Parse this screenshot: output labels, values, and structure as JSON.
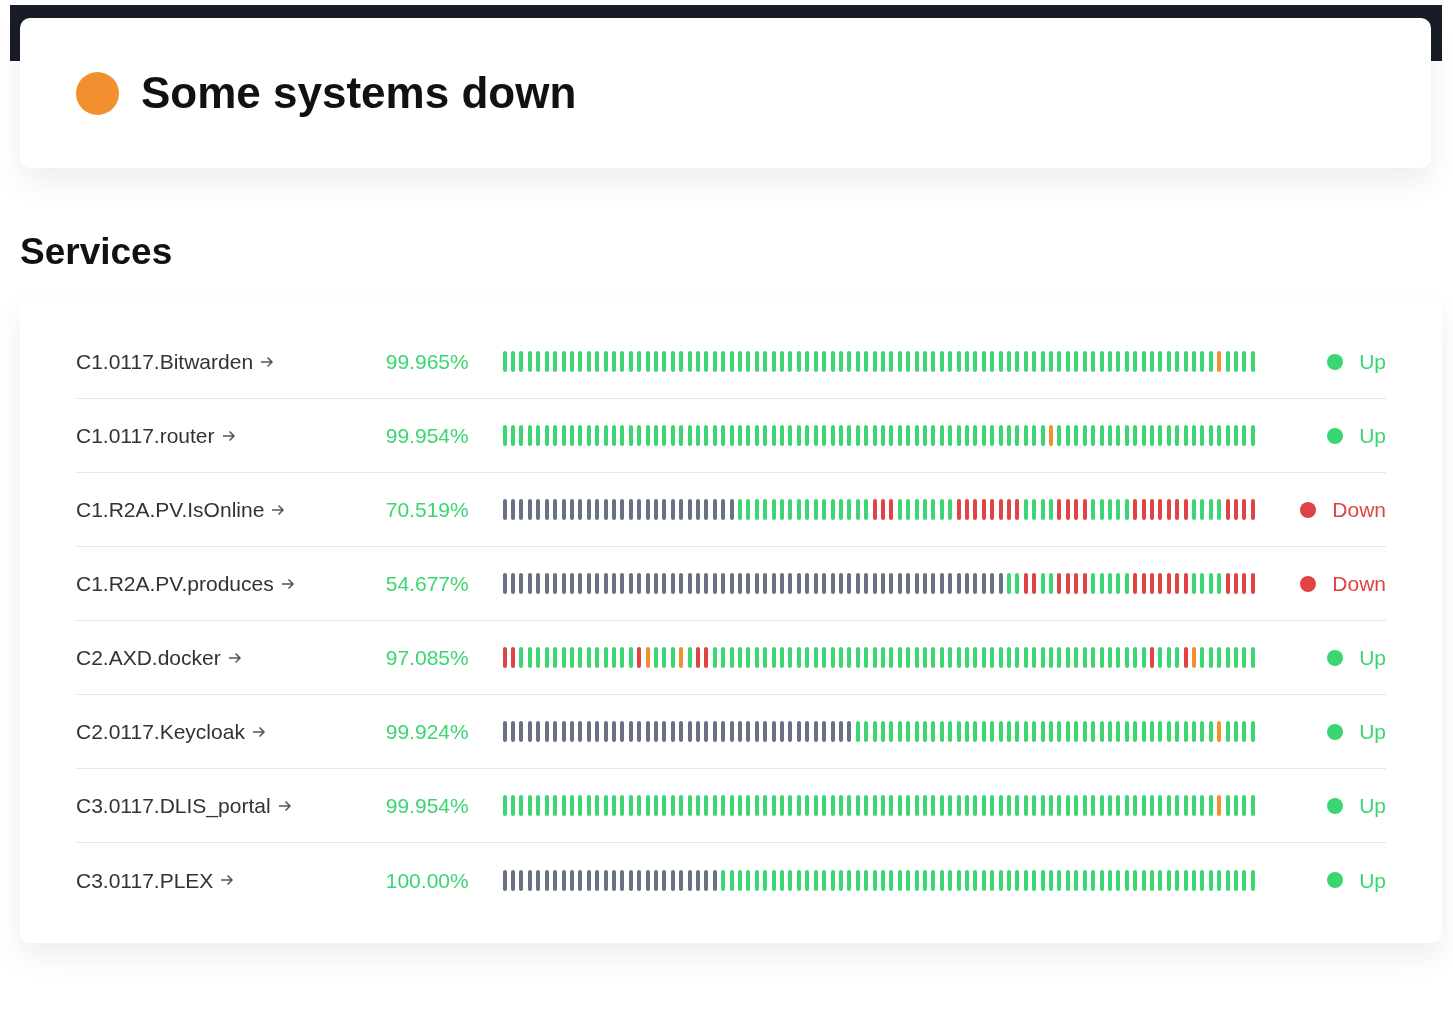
{
  "header": {
    "title": "Some systems down",
    "color": "#f29030"
  },
  "section_title": "Services",
  "services": [
    {
      "name": "C1.0117.Bitwarden",
      "uptime": "99.965%",
      "down": false,
      "status_label": "Up",
      "history": [
        {
          "color": "#3bd671"
        },
        {
          "color": "#3bd671"
        },
        {
          "color": "#3bd671"
        },
        {
          "color": "#3bd671"
        },
        {
          "color": "#3bd671"
        },
        {
          "color": "#3bd671"
        },
        {
          "color": "#3bd671"
        },
        {
          "color": "#3bd671"
        },
        {
          "color": "#3bd671"
        },
        {
          "color": "#3bd671"
        },
        {
          "color": "#3bd671"
        },
        {
          "color": "#3bd671"
        },
        {
          "color": "#3bd671"
        },
        {
          "color": "#3bd671"
        },
        {
          "color": "#3bd671"
        },
        {
          "color": "#3bd671"
        },
        {
          "color": "#3bd671"
        },
        {
          "color": "#3bd671"
        },
        {
          "color": "#3bd671"
        },
        {
          "color": "#3bd671"
        },
        {
          "color": "#3bd671"
        },
        {
          "color": "#3bd671"
        },
        {
          "color": "#3bd671"
        },
        {
          "color": "#3bd671"
        },
        {
          "color": "#3bd671"
        },
        {
          "color": "#3bd671"
        },
        {
          "color": "#3bd671"
        },
        {
          "color": "#3bd671"
        },
        {
          "color": "#3bd671"
        },
        {
          "color": "#3bd671"
        },
        {
          "color": "#3bd671"
        },
        {
          "color": "#3bd671"
        },
        {
          "color": "#3bd671"
        },
        {
          "color": "#3bd671"
        },
        {
          "color": "#3bd671"
        },
        {
          "color": "#3bd671"
        },
        {
          "color": "#3bd671"
        },
        {
          "color": "#3bd671"
        },
        {
          "color": "#3bd671"
        },
        {
          "color": "#3bd671"
        },
        {
          "color": "#3bd671"
        },
        {
          "color": "#3bd671"
        },
        {
          "color": "#3bd671"
        },
        {
          "color": "#3bd671"
        },
        {
          "color": "#3bd671"
        },
        {
          "color": "#3bd671"
        },
        {
          "color": "#3bd671"
        },
        {
          "color": "#3bd671"
        },
        {
          "color": "#3bd671"
        },
        {
          "color": "#3bd671"
        },
        {
          "color": "#3bd671"
        },
        {
          "color": "#3bd671"
        },
        {
          "color": "#3bd671"
        },
        {
          "color": "#3bd671"
        },
        {
          "color": "#3bd671"
        },
        {
          "color": "#3bd671"
        },
        {
          "color": "#3bd671"
        },
        {
          "color": "#3bd671"
        },
        {
          "color": "#3bd671"
        },
        {
          "color": "#3bd671"
        },
        {
          "color": "#3bd671"
        },
        {
          "color": "#3bd671"
        },
        {
          "color": "#3bd671"
        },
        {
          "color": "#3bd671"
        },
        {
          "color": "#3bd671"
        },
        {
          "color": "#3bd671"
        },
        {
          "color": "#3bd671"
        },
        {
          "color": "#3bd671"
        },
        {
          "color": "#3bd671"
        },
        {
          "color": "#3bd671"
        },
        {
          "color": "#3bd671"
        },
        {
          "color": "#3bd671"
        },
        {
          "color": "#3bd671"
        },
        {
          "color": "#3bd671"
        },
        {
          "color": "#3bd671"
        },
        {
          "color": "#3bd671"
        },
        {
          "color": "#3bd671"
        },
        {
          "color": "#3bd671"
        },
        {
          "color": "#3bd671"
        },
        {
          "color": "#3bd671"
        },
        {
          "color": "#3bd671"
        },
        {
          "color": "#3bd671"
        },
        {
          "color": "#3bd671"
        },
        {
          "color": "#3bd671"
        },
        {
          "color": "#3bd671"
        },
        {
          "color": "#f29030"
        },
        {
          "color": "#3bd671"
        },
        {
          "color": "#3bd671"
        },
        {
          "color": "#3bd671"
        },
        {
          "color": "#3bd671"
        }
      ]
    },
    {
      "name": "C1.0117.router",
      "uptime": "99.954%",
      "down": false,
      "status_label": "Up",
      "history": [
        {
          "color": "#3bd671"
        },
        {
          "color": "#3bd671"
        },
        {
          "color": "#3bd671"
        },
        {
          "color": "#3bd671"
        },
        {
          "color": "#3bd671"
        },
        {
          "color": "#3bd671"
        },
        {
          "color": "#3bd671"
        },
        {
          "color": "#3bd671"
        },
        {
          "color": "#3bd671"
        },
        {
          "color": "#3bd671"
        },
        {
          "color": "#3bd671"
        },
        {
          "color": "#3bd671"
        },
        {
          "color": "#3bd671"
        },
        {
          "color": "#3bd671"
        },
        {
          "color": "#3bd671"
        },
        {
          "color": "#3bd671"
        },
        {
          "color": "#3bd671"
        },
        {
          "color": "#3bd671"
        },
        {
          "color": "#3bd671"
        },
        {
          "color": "#3bd671"
        },
        {
          "color": "#3bd671"
        },
        {
          "color": "#3bd671"
        },
        {
          "color": "#3bd671"
        },
        {
          "color": "#3bd671"
        },
        {
          "color": "#3bd671"
        },
        {
          "color": "#3bd671"
        },
        {
          "color": "#3bd671"
        },
        {
          "color": "#3bd671"
        },
        {
          "color": "#3bd671"
        },
        {
          "color": "#3bd671"
        },
        {
          "color": "#3bd671"
        },
        {
          "color": "#3bd671"
        },
        {
          "color": "#3bd671"
        },
        {
          "color": "#3bd671"
        },
        {
          "color": "#3bd671"
        },
        {
          "color": "#3bd671"
        },
        {
          "color": "#3bd671"
        },
        {
          "color": "#3bd671"
        },
        {
          "color": "#3bd671"
        },
        {
          "color": "#3bd671"
        },
        {
          "color": "#3bd671"
        },
        {
          "color": "#3bd671"
        },
        {
          "color": "#3bd671"
        },
        {
          "color": "#3bd671"
        },
        {
          "color": "#3bd671"
        },
        {
          "color": "#3bd671"
        },
        {
          "color": "#3bd671"
        },
        {
          "color": "#3bd671"
        },
        {
          "color": "#3bd671"
        },
        {
          "color": "#3bd671"
        },
        {
          "color": "#3bd671"
        },
        {
          "color": "#3bd671"
        },
        {
          "color": "#3bd671"
        },
        {
          "color": "#3bd671"
        },
        {
          "color": "#3bd671"
        },
        {
          "color": "#3bd671"
        },
        {
          "color": "#3bd671"
        },
        {
          "color": "#3bd671"
        },
        {
          "color": "#3bd671"
        },
        {
          "color": "#3bd671"
        },
        {
          "color": "#3bd671"
        },
        {
          "color": "#3bd671"
        },
        {
          "color": "#3bd671"
        },
        {
          "color": "#3bd671"
        },
        {
          "color": "#3bd671"
        },
        {
          "color": "#f29030"
        },
        {
          "color": "#3bd671"
        },
        {
          "color": "#3bd671"
        },
        {
          "color": "#3bd671"
        },
        {
          "color": "#3bd671"
        },
        {
          "color": "#3bd671"
        },
        {
          "color": "#3bd671"
        },
        {
          "color": "#3bd671"
        },
        {
          "color": "#3bd671"
        },
        {
          "color": "#3bd671"
        },
        {
          "color": "#3bd671"
        },
        {
          "color": "#3bd671"
        },
        {
          "color": "#3bd671"
        },
        {
          "color": "#3bd671"
        },
        {
          "color": "#3bd671"
        },
        {
          "color": "#3bd671"
        },
        {
          "color": "#3bd671"
        },
        {
          "color": "#3bd671"
        },
        {
          "color": "#3bd671"
        },
        {
          "color": "#3bd671"
        },
        {
          "color": "#3bd671"
        },
        {
          "color": "#3bd671"
        },
        {
          "color": "#3bd671"
        },
        {
          "color": "#3bd671"
        },
        {
          "color": "#3bd671"
        }
      ]
    },
    {
      "name": "C1.R2A.PV.IsOnline",
      "uptime": "70.519%",
      "down": true,
      "status_label": "Down",
      "history": [
        {
          "color": "#687183"
        },
        {
          "color": "#687183"
        },
        {
          "color": "#687183"
        },
        {
          "color": "#687183"
        },
        {
          "color": "#687183"
        },
        {
          "color": "#687183"
        },
        {
          "color": "#687183"
        },
        {
          "color": "#687183"
        },
        {
          "color": "#687183"
        },
        {
          "color": "#687183"
        },
        {
          "color": "#687183"
        },
        {
          "color": "#687183"
        },
        {
          "color": "#687183"
        },
        {
          "color": "#687183"
        },
        {
          "color": "#687183"
        },
        {
          "color": "#687183"
        },
        {
          "color": "#687183"
        },
        {
          "color": "#687183"
        },
        {
          "color": "#687183"
        },
        {
          "color": "#687183"
        },
        {
          "color": "#687183"
        },
        {
          "color": "#687183"
        },
        {
          "color": "#687183"
        },
        {
          "color": "#687183"
        },
        {
          "color": "#687183"
        },
        {
          "color": "#687183"
        },
        {
          "color": "#687183"
        },
        {
          "color": "#687183"
        },
        {
          "color": "#3bd671"
        },
        {
          "color": "#3bd671"
        },
        {
          "color": "#3bd671"
        },
        {
          "color": "#3bd671"
        },
        {
          "color": "#3bd671"
        },
        {
          "color": "#3bd671"
        },
        {
          "color": "#3bd671"
        },
        {
          "color": "#3bd671"
        },
        {
          "color": "#3bd671"
        },
        {
          "color": "#3bd671"
        },
        {
          "color": "#3bd671"
        },
        {
          "color": "#3bd671"
        },
        {
          "color": "#3bd671"
        },
        {
          "color": "#3bd671"
        },
        {
          "color": "#3bd671"
        },
        {
          "color": "#3bd671"
        },
        {
          "color": "#e04343"
        },
        {
          "color": "#e04343"
        },
        {
          "color": "#e04343"
        },
        {
          "color": "#3bd671"
        },
        {
          "color": "#3bd671"
        },
        {
          "color": "#3bd671"
        },
        {
          "color": "#3bd671"
        },
        {
          "color": "#3bd671"
        },
        {
          "color": "#3bd671"
        },
        {
          "color": "#3bd671"
        },
        {
          "color": "#e04343"
        },
        {
          "color": "#e04343"
        },
        {
          "color": "#e04343"
        },
        {
          "color": "#e04343"
        },
        {
          "color": "#e04343"
        },
        {
          "color": "#e04343"
        },
        {
          "color": "#e04343"
        },
        {
          "color": "#e04343"
        },
        {
          "color": "#3bd671"
        },
        {
          "color": "#3bd671"
        },
        {
          "color": "#3bd671"
        },
        {
          "color": "#3bd671"
        },
        {
          "color": "#e04343"
        },
        {
          "color": "#e04343"
        },
        {
          "color": "#e04343"
        },
        {
          "color": "#e04343"
        },
        {
          "color": "#3bd671"
        },
        {
          "color": "#3bd671"
        },
        {
          "color": "#3bd671"
        },
        {
          "color": "#3bd671"
        },
        {
          "color": "#3bd671"
        },
        {
          "color": "#e04343"
        },
        {
          "color": "#e04343"
        },
        {
          "color": "#e04343"
        },
        {
          "color": "#e04343"
        },
        {
          "color": "#e04343"
        },
        {
          "color": "#e04343"
        },
        {
          "color": "#e04343"
        },
        {
          "color": "#3bd671"
        },
        {
          "color": "#3bd671"
        },
        {
          "color": "#3bd671"
        },
        {
          "color": "#3bd671"
        },
        {
          "color": "#e04343"
        },
        {
          "color": "#e04343"
        },
        {
          "color": "#e04343"
        },
        {
          "color": "#e04343"
        }
      ]
    },
    {
      "name": "C1.R2A.PV.produces",
      "uptime": "54.677%",
      "down": true,
      "status_label": "Down",
      "history": [
        {
          "color": "#687183"
        },
        {
          "color": "#687183"
        },
        {
          "color": "#687183"
        },
        {
          "color": "#687183"
        },
        {
          "color": "#687183"
        },
        {
          "color": "#687183"
        },
        {
          "color": "#687183"
        },
        {
          "color": "#687183"
        },
        {
          "color": "#687183"
        },
        {
          "color": "#687183"
        },
        {
          "color": "#687183"
        },
        {
          "color": "#687183"
        },
        {
          "color": "#687183"
        },
        {
          "color": "#687183"
        },
        {
          "color": "#687183"
        },
        {
          "color": "#687183"
        },
        {
          "color": "#687183"
        },
        {
          "color": "#687183"
        },
        {
          "color": "#687183"
        },
        {
          "color": "#687183"
        },
        {
          "color": "#687183"
        },
        {
          "color": "#687183"
        },
        {
          "color": "#687183"
        },
        {
          "color": "#687183"
        },
        {
          "color": "#687183"
        },
        {
          "color": "#687183"
        },
        {
          "color": "#687183"
        },
        {
          "color": "#687183"
        },
        {
          "color": "#687183"
        },
        {
          "color": "#687183"
        },
        {
          "color": "#687183"
        },
        {
          "color": "#687183"
        },
        {
          "color": "#687183"
        },
        {
          "color": "#687183"
        },
        {
          "color": "#687183"
        },
        {
          "color": "#687183"
        },
        {
          "color": "#687183"
        },
        {
          "color": "#687183"
        },
        {
          "color": "#687183"
        },
        {
          "color": "#687183"
        },
        {
          "color": "#687183"
        },
        {
          "color": "#687183"
        },
        {
          "color": "#687183"
        },
        {
          "color": "#687183"
        },
        {
          "color": "#687183"
        },
        {
          "color": "#687183"
        },
        {
          "color": "#687183"
        },
        {
          "color": "#687183"
        },
        {
          "color": "#687183"
        },
        {
          "color": "#687183"
        },
        {
          "color": "#687183"
        },
        {
          "color": "#687183"
        },
        {
          "color": "#687183"
        },
        {
          "color": "#687183"
        },
        {
          "color": "#687183"
        },
        {
          "color": "#687183"
        },
        {
          "color": "#687183"
        },
        {
          "color": "#687183"
        },
        {
          "color": "#687183"
        },
        {
          "color": "#687183"
        },
        {
          "color": "#3bd671"
        },
        {
          "color": "#3bd671"
        },
        {
          "color": "#e04343"
        },
        {
          "color": "#e04343"
        },
        {
          "color": "#3bd671"
        },
        {
          "color": "#3bd671"
        },
        {
          "color": "#e04343"
        },
        {
          "color": "#e04343"
        },
        {
          "color": "#e04343"
        },
        {
          "color": "#e04343"
        },
        {
          "color": "#3bd671"
        },
        {
          "color": "#3bd671"
        },
        {
          "color": "#3bd671"
        },
        {
          "color": "#3bd671"
        },
        {
          "color": "#3bd671"
        },
        {
          "color": "#e04343"
        },
        {
          "color": "#e04343"
        },
        {
          "color": "#e04343"
        },
        {
          "color": "#e04343"
        },
        {
          "color": "#e04343"
        },
        {
          "color": "#e04343"
        },
        {
          "color": "#e04343"
        },
        {
          "color": "#3bd671"
        },
        {
          "color": "#3bd671"
        },
        {
          "color": "#3bd671"
        },
        {
          "color": "#3bd671"
        },
        {
          "color": "#e04343"
        },
        {
          "color": "#e04343"
        },
        {
          "color": "#e04343"
        },
        {
          "color": "#e04343"
        }
      ]
    },
    {
      "name": "C2.AXD.docker",
      "uptime": "97.085%",
      "down": false,
      "status_label": "Up",
      "history": [
        {
          "color": "#e04343"
        },
        {
          "color": "#e04343"
        },
        {
          "color": "#3bd671"
        },
        {
          "color": "#3bd671"
        },
        {
          "color": "#3bd671"
        },
        {
          "color": "#3bd671"
        },
        {
          "color": "#3bd671"
        },
        {
          "color": "#3bd671"
        },
        {
          "color": "#3bd671"
        },
        {
          "color": "#3bd671"
        },
        {
          "color": "#3bd671"
        },
        {
          "color": "#3bd671"
        },
        {
          "color": "#3bd671"
        },
        {
          "color": "#3bd671"
        },
        {
          "color": "#3bd671"
        },
        {
          "color": "#3bd671"
        },
        {
          "color": "#e04343"
        },
        {
          "color": "#f29030"
        },
        {
          "color": "#3bd671"
        },
        {
          "color": "#3bd671"
        },
        {
          "color": "#3bd671"
        },
        {
          "color": "#f29030"
        },
        {
          "color": "#3bd671"
        },
        {
          "color": "#e04343"
        },
        {
          "color": "#e04343"
        },
        {
          "color": "#3bd671"
        },
        {
          "color": "#3bd671"
        },
        {
          "color": "#3bd671"
        },
        {
          "color": "#3bd671"
        },
        {
          "color": "#3bd671"
        },
        {
          "color": "#3bd671"
        },
        {
          "color": "#3bd671"
        },
        {
          "color": "#3bd671"
        },
        {
          "color": "#3bd671"
        },
        {
          "color": "#3bd671"
        },
        {
          "color": "#3bd671"
        },
        {
          "color": "#3bd671"
        },
        {
          "color": "#3bd671"
        },
        {
          "color": "#3bd671"
        },
        {
          "color": "#3bd671"
        },
        {
          "color": "#3bd671"
        },
        {
          "color": "#3bd671"
        },
        {
          "color": "#3bd671"
        },
        {
          "color": "#3bd671"
        },
        {
          "color": "#3bd671"
        },
        {
          "color": "#3bd671"
        },
        {
          "color": "#3bd671"
        },
        {
          "color": "#3bd671"
        },
        {
          "color": "#3bd671"
        },
        {
          "color": "#3bd671"
        },
        {
          "color": "#3bd671"
        },
        {
          "color": "#3bd671"
        },
        {
          "color": "#3bd671"
        },
        {
          "color": "#3bd671"
        },
        {
          "color": "#3bd671"
        },
        {
          "color": "#3bd671"
        },
        {
          "color": "#3bd671"
        },
        {
          "color": "#3bd671"
        },
        {
          "color": "#3bd671"
        },
        {
          "color": "#3bd671"
        },
        {
          "color": "#3bd671"
        },
        {
          "color": "#3bd671"
        },
        {
          "color": "#3bd671"
        },
        {
          "color": "#3bd671"
        },
        {
          "color": "#3bd671"
        },
        {
          "color": "#3bd671"
        },
        {
          "color": "#3bd671"
        },
        {
          "color": "#3bd671"
        },
        {
          "color": "#3bd671"
        },
        {
          "color": "#3bd671"
        },
        {
          "color": "#3bd671"
        },
        {
          "color": "#3bd671"
        },
        {
          "color": "#3bd671"
        },
        {
          "color": "#3bd671"
        },
        {
          "color": "#3bd671"
        },
        {
          "color": "#3bd671"
        },
        {
          "color": "#3bd671"
        },
        {
          "color": "#e04343"
        },
        {
          "color": "#3bd671"
        },
        {
          "color": "#3bd671"
        },
        {
          "color": "#3bd671"
        },
        {
          "color": "#e04343"
        },
        {
          "color": "#f29030"
        },
        {
          "color": "#3bd671"
        },
        {
          "color": "#3bd671"
        },
        {
          "color": "#3bd671"
        },
        {
          "color": "#3bd671"
        },
        {
          "color": "#3bd671"
        },
        {
          "color": "#3bd671"
        },
        {
          "color": "#3bd671"
        }
      ]
    },
    {
      "name": "C2.0117.Keycloak",
      "uptime": "99.924%",
      "down": false,
      "status_label": "Up",
      "history": [
        {
          "color": "#687183"
        },
        {
          "color": "#687183"
        },
        {
          "color": "#687183"
        },
        {
          "color": "#687183"
        },
        {
          "color": "#687183"
        },
        {
          "color": "#687183"
        },
        {
          "color": "#687183"
        },
        {
          "color": "#687183"
        },
        {
          "color": "#687183"
        },
        {
          "color": "#687183"
        },
        {
          "color": "#687183"
        },
        {
          "color": "#687183"
        },
        {
          "color": "#687183"
        },
        {
          "color": "#687183"
        },
        {
          "color": "#687183"
        },
        {
          "color": "#687183"
        },
        {
          "color": "#687183"
        },
        {
          "color": "#687183"
        },
        {
          "color": "#687183"
        },
        {
          "color": "#687183"
        },
        {
          "color": "#687183"
        },
        {
          "color": "#687183"
        },
        {
          "color": "#687183"
        },
        {
          "color": "#687183"
        },
        {
          "color": "#687183"
        },
        {
          "color": "#687183"
        },
        {
          "color": "#687183"
        },
        {
          "color": "#687183"
        },
        {
          "color": "#687183"
        },
        {
          "color": "#687183"
        },
        {
          "color": "#687183"
        },
        {
          "color": "#687183"
        },
        {
          "color": "#687183"
        },
        {
          "color": "#687183"
        },
        {
          "color": "#687183"
        },
        {
          "color": "#687183"
        },
        {
          "color": "#687183"
        },
        {
          "color": "#687183"
        },
        {
          "color": "#687183"
        },
        {
          "color": "#687183"
        },
        {
          "color": "#687183"
        },
        {
          "color": "#687183"
        },
        {
          "color": "#3bd671"
        },
        {
          "color": "#3bd671"
        },
        {
          "color": "#3bd671"
        },
        {
          "color": "#3bd671"
        },
        {
          "color": "#3bd671"
        },
        {
          "color": "#3bd671"
        },
        {
          "color": "#3bd671"
        },
        {
          "color": "#3bd671"
        },
        {
          "color": "#3bd671"
        },
        {
          "color": "#3bd671"
        },
        {
          "color": "#3bd671"
        },
        {
          "color": "#3bd671"
        },
        {
          "color": "#3bd671"
        },
        {
          "color": "#3bd671"
        },
        {
          "color": "#3bd671"
        },
        {
          "color": "#3bd671"
        },
        {
          "color": "#3bd671"
        },
        {
          "color": "#3bd671"
        },
        {
          "color": "#3bd671"
        },
        {
          "color": "#3bd671"
        },
        {
          "color": "#3bd671"
        },
        {
          "color": "#3bd671"
        },
        {
          "color": "#3bd671"
        },
        {
          "color": "#3bd671"
        },
        {
          "color": "#3bd671"
        },
        {
          "color": "#3bd671"
        },
        {
          "color": "#3bd671"
        },
        {
          "color": "#3bd671"
        },
        {
          "color": "#3bd671"
        },
        {
          "color": "#3bd671"
        },
        {
          "color": "#3bd671"
        },
        {
          "color": "#3bd671"
        },
        {
          "color": "#3bd671"
        },
        {
          "color": "#3bd671"
        },
        {
          "color": "#3bd671"
        },
        {
          "color": "#3bd671"
        },
        {
          "color": "#3bd671"
        },
        {
          "color": "#3bd671"
        },
        {
          "color": "#3bd671"
        },
        {
          "color": "#3bd671"
        },
        {
          "color": "#3bd671"
        },
        {
          "color": "#3bd671"
        },
        {
          "color": "#3bd671"
        },
        {
          "color": "#f29030"
        },
        {
          "color": "#3bd671"
        },
        {
          "color": "#3bd671"
        },
        {
          "color": "#3bd671"
        },
        {
          "color": "#3bd671"
        }
      ]
    },
    {
      "name": "C3.0117.DLIS_portal",
      "uptime": "99.954%",
      "down": false,
      "status_label": "Up",
      "history": [
        {
          "color": "#3bd671"
        },
        {
          "color": "#3bd671"
        },
        {
          "color": "#3bd671"
        },
        {
          "color": "#3bd671"
        },
        {
          "color": "#3bd671"
        },
        {
          "color": "#3bd671"
        },
        {
          "color": "#3bd671"
        },
        {
          "color": "#3bd671"
        },
        {
          "color": "#3bd671"
        },
        {
          "color": "#3bd671"
        },
        {
          "color": "#3bd671"
        },
        {
          "color": "#3bd671"
        },
        {
          "color": "#3bd671"
        },
        {
          "color": "#3bd671"
        },
        {
          "color": "#3bd671"
        },
        {
          "color": "#3bd671"
        },
        {
          "color": "#3bd671"
        },
        {
          "color": "#3bd671"
        },
        {
          "color": "#3bd671"
        },
        {
          "color": "#3bd671"
        },
        {
          "color": "#3bd671"
        },
        {
          "color": "#3bd671"
        },
        {
          "color": "#3bd671"
        },
        {
          "color": "#3bd671"
        },
        {
          "color": "#3bd671"
        },
        {
          "color": "#3bd671"
        },
        {
          "color": "#3bd671"
        },
        {
          "color": "#3bd671"
        },
        {
          "color": "#3bd671"
        },
        {
          "color": "#3bd671"
        },
        {
          "color": "#3bd671"
        },
        {
          "color": "#3bd671"
        },
        {
          "color": "#3bd671"
        },
        {
          "color": "#3bd671"
        },
        {
          "color": "#3bd671"
        },
        {
          "color": "#3bd671"
        },
        {
          "color": "#3bd671"
        },
        {
          "color": "#3bd671"
        },
        {
          "color": "#3bd671"
        },
        {
          "color": "#3bd671"
        },
        {
          "color": "#3bd671"
        },
        {
          "color": "#3bd671"
        },
        {
          "color": "#3bd671"
        },
        {
          "color": "#3bd671"
        },
        {
          "color": "#3bd671"
        },
        {
          "color": "#3bd671"
        },
        {
          "color": "#3bd671"
        },
        {
          "color": "#3bd671"
        },
        {
          "color": "#3bd671"
        },
        {
          "color": "#3bd671"
        },
        {
          "color": "#3bd671"
        },
        {
          "color": "#3bd671"
        },
        {
          "color": "#3bd671"
        },
        {
          "color": "#3bd671"
        },
        {
          "color": "#3bd671"
        },
        {
          "color": "#3bd671"
        },
        {
          "color": "#3bd671"
        },
        {
          "color": "#3bd671"
        },
        {
          "color": "#3bd671"
        },
        {
          "color": "#3bd671"
        },
        {
          "color": "#3bd671"
        },
        {
          "color": "#3bd671"
        },
        {
          "color": "#3bd671"
        },
        {
          "color": "#3bd671"
        },
        {
          "color": "#3bd671"
        },
        {
          "color": "#3bd671"
        },
        {
          "color": "#3bd671"
        },
        {
          "color": "#3bd671"
        },
        {
          "color": "#3bd671"
        },
        {
          "color": "#3bd671"
        },
        {
          "color": "#3bd671"
        },
        {
          "color": "#3bd671"
        },
        {
          "color": "#3bd671"
        },
        {
          "color": "#3bd671"
        },
        {
          "color": "#3bd671"
        },
        {
          "color": "#3bd671"
        },
        {
          "color": "#3bd671"
        },
        {
          "color": "#3bd671"
        },
        {
          "color": "#3bd671"
        },
        {
          "color": "#3bd671"
        },
        {
          "color": "#3bd671"
        },
        {
          "color": "#3bd671"
        },
        {
          "color": "#3bd671"
        },
        {
          "color": "#3bd671"
        },
        {
          "color": "#3bd671"
        },
        {
          "color": "#f29030"
        },
        {
          "color": "#3bd671"
        },
        {
          "color": "#3bd671"
        },
        {
          "color": "#3bd671"
        },
        {
          "color": "#3bd671"
        }
      ]
    },
    {
      "name": "C3.0117.PLEX",
      "uptime": "100.00%",
      "down": false,
      "status_label": "Up",
      "history": [
        {
          "color": "#687183"
        },
        {
          "color": "#687183"
        },
        {
          "color": "#687183"
        },
        {
          "color": "#687183"
        },
        {
          "color": "#687183"
        },
        {
          "color": "#687183"
        },
        {
          "color": "#687183"
        },
        {
          "color": "#687183"
        },
        {
          "color": "#687183"
        },
        {
          "color": "#687183"
        },
        {
          "color": "#687183"
        },
        {
          "color": "#687183"
        },
        {
          "color": "#687183"
        },
        {
          "color": "#687183"
        },
        {
          "color": "#687183"
        },
        {
          "color": "#687183"
        },
        {
          "color": "#687183"
        },
        {
          "color": "#687183"
        },
        {
          "color": "#687183"
        },
        {
          "color": "#687183"
        },
        {
          "color": "#687183"
        },
        {
          "color": "#687183"
        },
        {
          "color": "#687183"
        },
        {
          "color": "#687183"
        },
        {
          "color": "#687183"
        },
        {
          "color": "#687183"
        },
        {
          "color": "#3bd671"
        },
        {
          "color": "#3bd671"
        },
        {
          "color": "#3bd671"
        },
        {
          "color": "#3bd671"
        },
        {
          "color": "#3bd671"
        },
        {
          "color": "#3bd671"
        },
        {
          "color": "#3bd671"
        },
        {
          "color": "#3bd671"
        },
        {
          "color": "#3bd671"
        },
        {
          "color": "#3bd671"
        },
        {
          "color": "#3bd671"
        },
        {
          "color": "#3bd671"
        },
        {
          "color": "#3bd671"
        },
        {
          "color": "#3bd671"
        },
        {
          "color": "#3bd671"
        },
        {
          "color": "#3bd671"
        },
        {
          "color": "#3bd671"
        },
        {
          "color": "#3bd671"
        },
        {
          "color": "#3bd671"
        },
        {
          "color": "#3bd671"
        },
        {
          "color": "#3bd671"
        },
        {
          "color": "#3bd671"
        },
        {
          "color": "#3bd671"
        },
        {
          "color": "#3bd671"
        },
        {
          "color": "#3bd671"
        },
        {
          "color": "#3bd671"
        },
        {
          "color": "#3bd671"
        },
        {
          "color": "#3bd671"
        },
        {
          "color": "#3bd671"
        },
        {
          "color": "#3bd671"
        },
        {
          "color": "#3bd671"
        },
        {
          "color": "#3bd671"
        },
        {
          "color": "#3bd671"
        },
        {
          "color": "#3bd671"
        },
        {
          "color": "#3bd671"
        },
        {
          "color": "#3bd671"
        },
        {
          "color": "#3bd671"
        },
        {
          "color": "#3bd671"
        },
        {
          "color": "#3bd671"
        },
        {
          "color": "#3bd671"
        },
        {
          "color": "#3bd671"
        },
        {
          "color": "#3bd671"
        },
        {
          "color": "#3bd671"
        },
        {
          "color": "#3bd671"
        },
        {
          "color": "#3bd671"
        },
        {
          "color": "#3bd671"
        },
        {
          "color": "#3bd671"
        },
        {
          "color": "#3bd671"
        },
        {
          "color": "#3bd671"
        },
        {
          "color": "#3bd671"
        },
        {
          "color": "#3bd671"
        },
        {
          "color": "#3bd671"
        },
        {
          "color": "#3bd671"
        },
        {
          "color": "#3bd671"
        },
        {
          "color": "#3bd671"
        },
        {
          "color": "#3bd671"
        },
        {
          "color": "#3bd671"
        },
        {
          "color": "#3bd671"
        },
        {
          "color": "#3bd671"
        },
        {
          "color": "#3bd671"
        },
        {
          "color": "#3bd671"
        },
        {
          "color": "#3bd671"
        },
        {
          "color": "#3bd671"
        },
        {
          "color": "#3bd671"
        }
      ]
    }
  ]
}
